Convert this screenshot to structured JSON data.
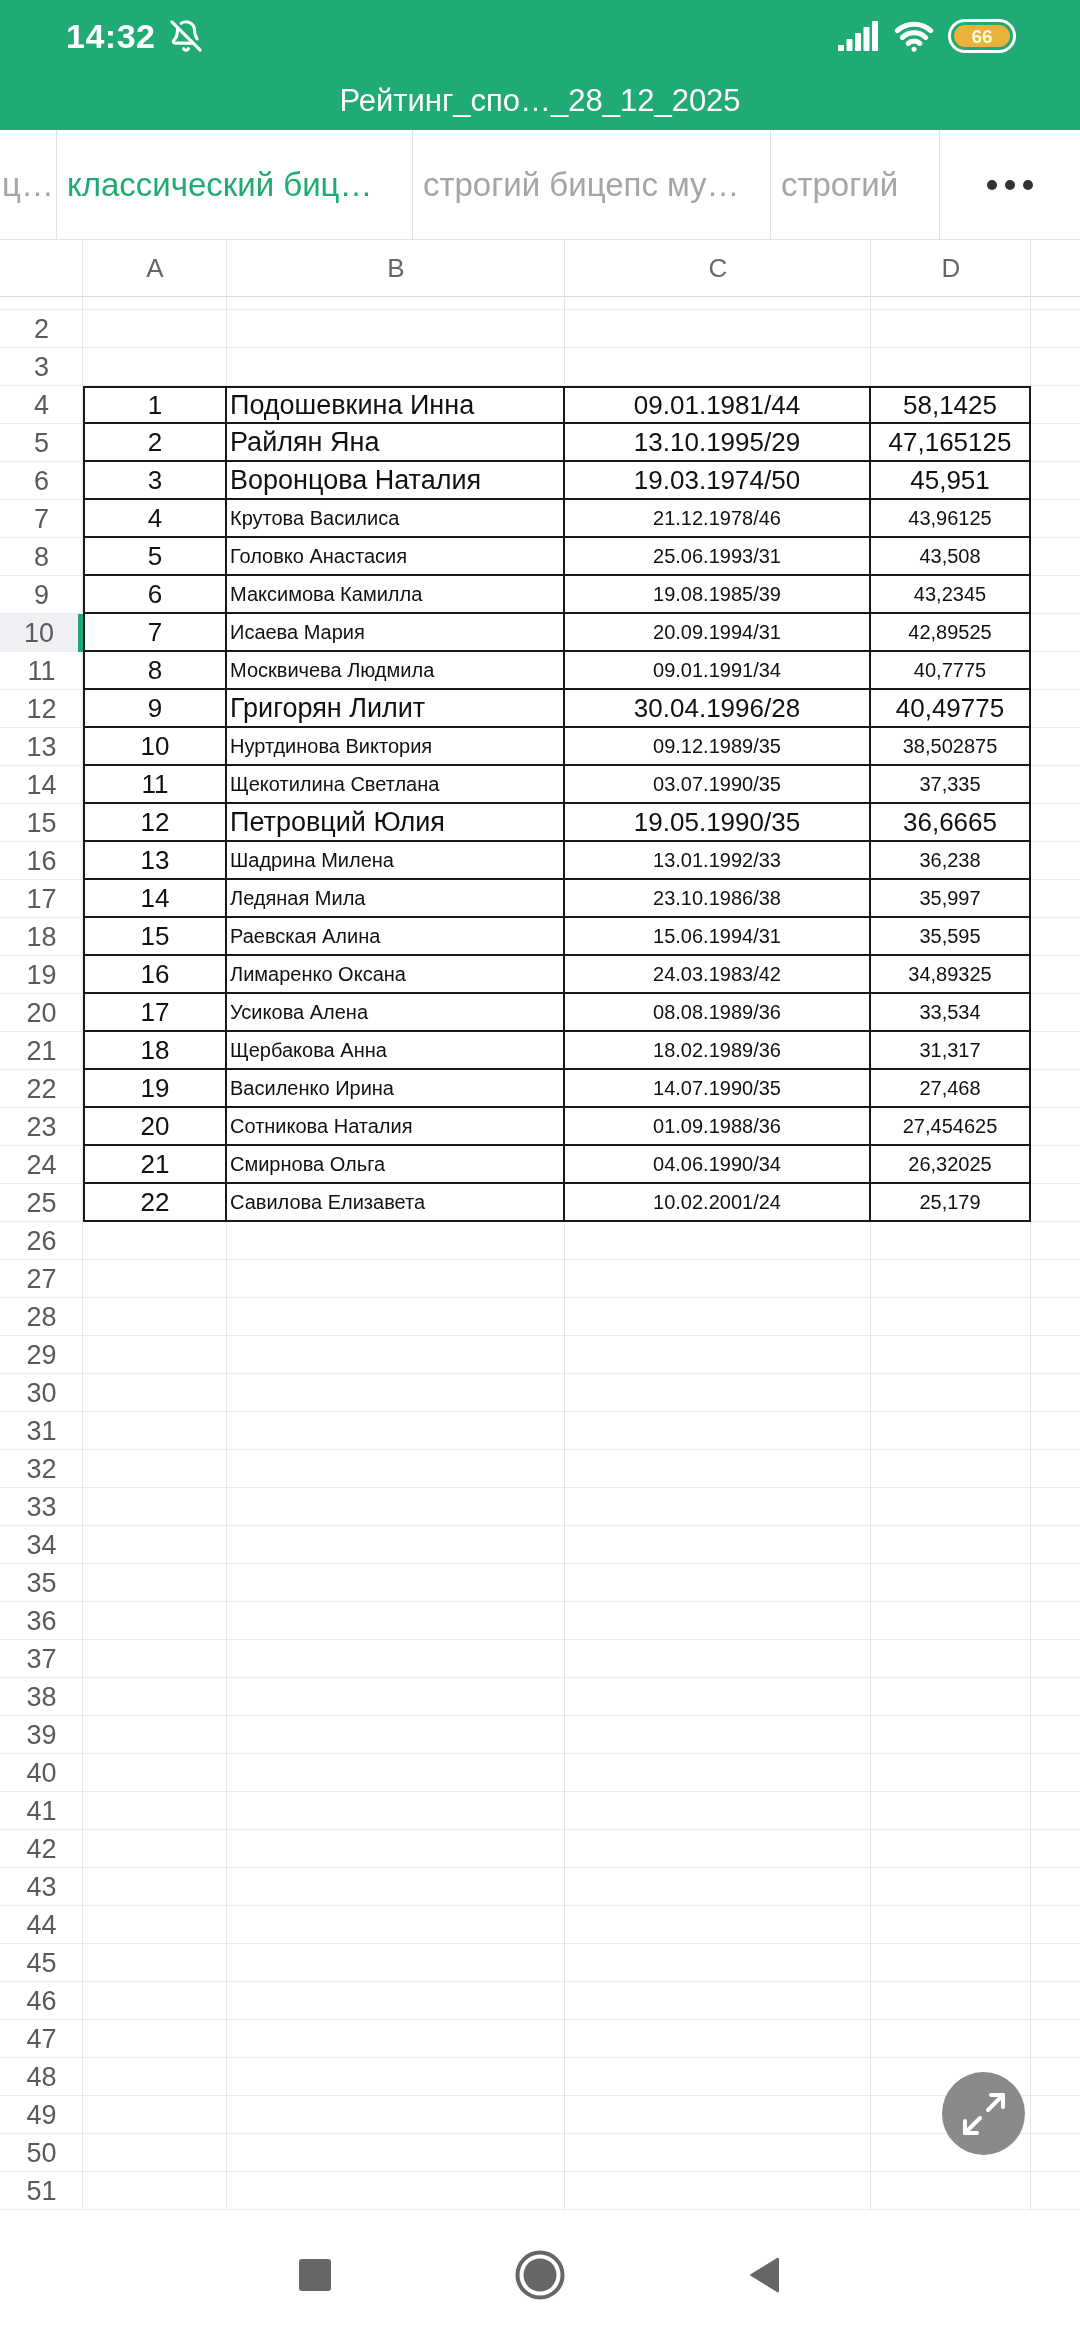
{
  "status_bar": {
    "time": "14:32",
    "battery": "66"
  },
  "document": {
    "title": "Рейтинг_спо…_28_12_2025"
  },
  "tabs": [
    {
      "label": "ц…",
      "selected": false
    },
    {
      "label": "классический биц…",
      "selected": true
    },
    {
      "label": "строгий бицепс му…",
      "selected": false
    },
    {
      "label": "строгий",
      "selected": false
    }
  ],
  "sheet": {
    "columns": [
      "A",
      "B",
      "C",
      "D"
    ],
    "rows": [
      {
        "number": "2",
        "selected": false
      },
      {
        "number": "3",
        "selected": false
      },
      {
        "number": "4",
        "selected": false,
        "kind": "emphasized",
        "cells": [
          "1",
          "Подошевкина Инна",
          "09.01.1981/44",
          "58,1425"
        ]
      },
      {
        "number": "5",
        "selected": false,
        "kind": "emphasized",
        "cells": [
          "2",
          "Райлян Яна",
          "13.10.1995/29",
          "47,165125"
        ]
      },
      {
        "number": "6",
        "selected": false,
        "kind": "emphasized",
        "cells": [
          "3",
          "Воронцова Наталия",
          "19.03.1974/50",
          "45,951"
        ]
      },
      {
        "number": "7",
        "selected": false,
        "kind": "plain",
        "cells": [
          "4",
          "Крутова Василиса",
          "21.12.1978/46",
          "43,96125"
        ]
      },
      {
        "number": "8",
        "selected": false,
        "kind": "plain",
        "cells": [
          "5",
          "Головко Анастасия",
          "25.06.1993/31",
          "43,508"
        ]
      },
      {
        "number": "9",
        "selected": false,
        "kind": "plain",
        "cells": [
          "6",
          "Максимова Камилла",
          "19.08.1985/39",
          "43,2345"
        ]
      },
      {
        "number": "10",
        "selected": true,
        "kind": "plain",
        "cells": [
          "7",
          "Исаева Мария",
          "20.09.1994/31",
          "42,89525"
        ]
      },
      {
        "number": "11",
        "selected": false,
        "kind": "plain",
        "cells": [
          "8",
          "Москвичева Людмила",
          "09.01.1991/34",
          "40,7775"
        ]
      },
      {
        "number": "12",
        "selected": false,
        "kind": "emphasized",
        "cells": [
          "9",
          "Григорян Лилит",
          "30.04.1996/28",
          "40,49775"
        ]
      },
      {
        "number": "13",
        "selected": false,
        "kind": "plain",
        "cells": [
          "10",
          "Нуртдинова Виктория",
          "09.12.1989/35",
          "38,502875"
        ]
      },
      {
        "number": "14",
        "selected": false,
        "kind": "plain",
        "cells": [
          "11",
          "Щекотилина Светлана",
          "03.07.1990/35",
          "37,335"
        ]
      },
      {
        "number": "15",
        "selected": false,
        "kind": "emphasized",
        "cells": [
          "12",
          "Петровций Юлия",
          "19.05.1990/35",
          "36,6665"
        ]
      },
      {
        "number": "16",
        "selected": false,
        "kind": "plain",
        "cells": [
          "13",
          "Шадрина Милена",
          "13.01.1992/33",
          "36,238"
        ]
      },
      {
        "number": "17",
        "selected": false,
        "kind": "plain",
        "cells": [
          "14",
          "Ледяная Мила",
          "23.10.1986/38",
          "35,997"
        ]
      },
      {
        "number": "18",
        "selected": false,
        "kind": "plain",
        "cells": [
          "15",
          "Раевская Алина",
          "15.06.1994/31",
          "35,595"
        ]
      },
      {
        "number": "19",
        "selected": false,
        "kind": "plain",
        "cells": [
          "16",
          "Лимаренко Оксана",
          "24.03.1983/42",
          "34,89325"
        ]
      },
      {
        "number": "20",
        "selected": false,
        "kind": "plain",
        "cells": [
          "17",
          "Усикова Алена",
          "08.08.1989/36",
          "33,534"
        ]
      },
      {
        "number": "21",
        "selected": false,
        "kind": "plain",
        "cells": [
          "18",
          "Щербакова Анна",
          "18.02.1989/36",
          "31,317"
        ]
      },
      {
        "number": "22",
        "selected": false,
        "kind": "plain",
        "cells": [
          "19",
          "Василенко Ирина",
          "14.07.1990/35",
          "27,468"
        ]
      },
      {
        "number": "23",
        "selected": false,
        "kind": "plain",
        "cells": [
          "20",
          "Сотникова Наталия",
          "01.09.1988/36",
          "27,454625"
        ]
      },
      {
        "number": "24",
        "selected": false,
        "kind": "plain",
        "cells": [
          "21",
          "Смирнова Ольга",
          "04.06.1990/34",
          "26,32025"
        ]
      },
      {
        "number": "25",
        "selected": false,
        "kind": "plain",
        "cells": [
          "22",
          "Савилова Елизавета",
          "10.02.2001/24",
          "25,179"
        ]
      },
      {
        "number": "26",
        "selected": false
      },
      {
        "number": "27",
        "selected": false
      },
      {
        "number": "28",
        "selected": false
      },
      {
        "number": "29",
        "selected": false
      },
      {
        "number": "30",
        "selected": false
      },
      {
        "number": "31",
        "selected": false
      },
      {
        "number": "32",
        "selected": false
      },
      {
        "number": "33",
        "selected": false
      },
      {
        "number": "34",
        "selected": false
      },
      {
        "number": "35",
        "selected": false
      },
      {
        "number": "36",
        "selected": false
      },
      {
        "number": "37",
        "selected": false
      },
      {
        "number": "38",
        "selected": false
      },
      {
        "number": "39",
        "selected": false
      },
      {
        "number": "40",
        "selected": false
      },
      {
        "number": "41",
        "selected": false
      },
      {
        "number": "42",
        "selected": false
      },
      {
        "number": "43",
        "selected": false
      },
      {
        "number": "44",
        "selected": false
      },
      {
        "number": "45",
        "selected": false
      },
      {
        "number": "46",
        "selected": false
      },
      {
        "number": "47",
        "selected": false
      },
      {
        "number": "48",
        "selected": false
      },
      {
        "number": "49",
        "selected": false
      },
      {
        "number": "50",
        "selected": false
      },
      {
        "number": "51",
        "selected": false
      }
    ]
  }
}
